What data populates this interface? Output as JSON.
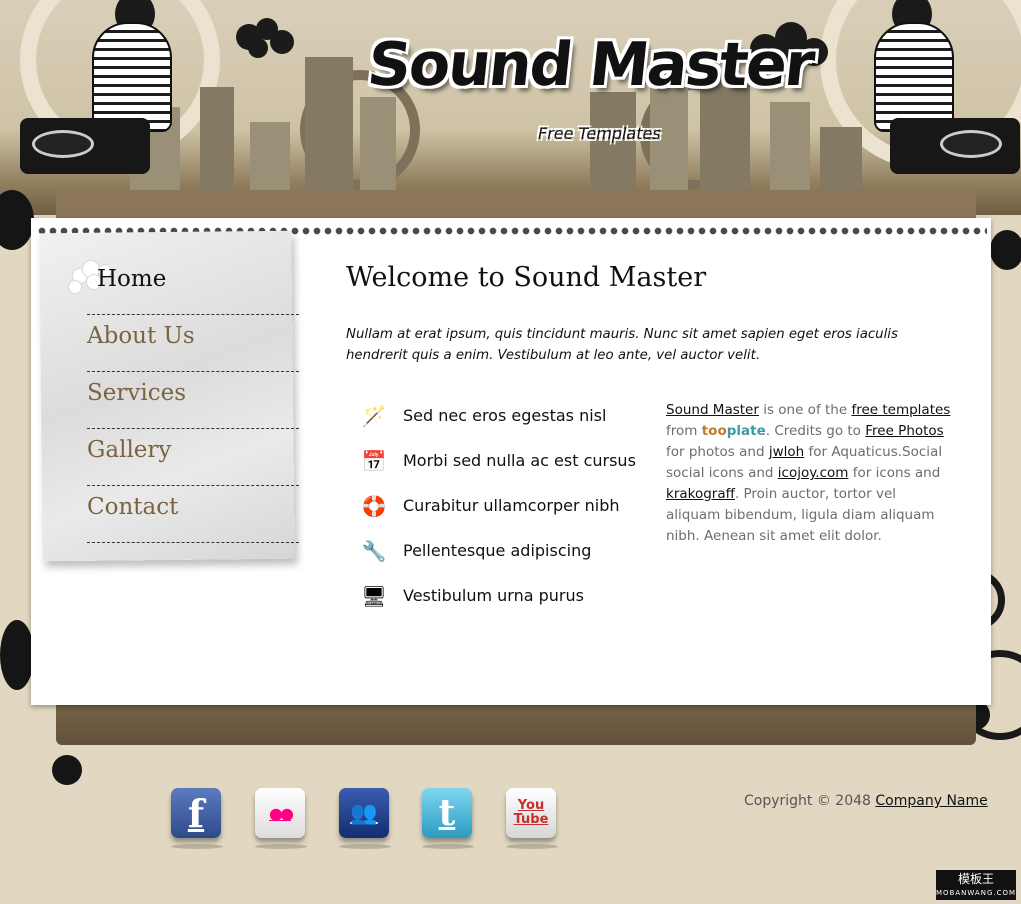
{
  "brand": {
    "title": "Sound Master",
    "tagline": "Free Templates"
  },
  "nav": {
    "items": [
      {
        "label": "Home",
        "active": true
      },
      {
        "label": "About Us",
        "active": false
      },
      {
        "label": "Services",
        "active": false
      },
      {
        "label": "Gallery",
        "active": false
      },
      {
        "label": "Contact",
        "active": false
      }
    ]
  },
  "main": {
    "heading": "Welcome to Sound Master",
    "intro": "Nullam at erat ipsum, quis tincidunt mauris. Nunc sit amet sapien eget eros iaculis hendrerit quis a enim. Vestibulum at leo ante, vel auctor velit.",
    "features": [
      {
        "icon": "magic-wand-icon",
        "glyph": "🪄",
        "label": "Sed nec eros egestas nisl"
      },
      {
        "icon": "calendar-icon",
        "glyph": "📅",
        "label": "Morbi sed nulla ac est cursus"
      },
      {
        "icon": "lifebuoy-icon",
        "glyph": "🛟",
        "label": "Curabitur ullamcorper nibh"
      },
      {
        "icon": "wrench-icon",
        "glyph": "🔧",
        "label": "Pellentesque adipiscing"
      },
      {
        "icon": "monitor-icon",
        "glyph": "🖥",
        "label": "Vestibulum urna purus"
      }
    ],
    "side": {
      "link_sound_master": "Sound Master",
      "t1": " is one of the ",
      "link_free_templates": "free templates",
      "t2": " from ",
      "too": "too",
      "plate": "plate",
      "t3": ". Credits go to ",
      "link_free_photos": "Free Photos",
      "t4": " for photos and ",
      "link_jwloh": "jwloh",
      "t5": " for Aquaticus.Social social icons and ",
      "link_icojoy": "icojoy.com",
      "t6": " for icons and ",
      "link_krakograff": "krakograff",
      "t7": ". Proin auctor, tortor vel aliquam bibendum, ligula diam aliquam nibh. Aenean sit amet elit dolor."
    }
  },
  "footer": {
    "social": [
      {
        "name": "facebook",
        "glyph": "f",
        "color": "#3b5998"
      },
      {
        "name": "flickr",
        "glyph": "●●",
        "color": "#f4f4f4"
      },
      {
        "name": "myspace",
        "glyph": "👥",
        "color": "#1f3f8a"
      },
      {
        "name": "twitter",
        "glyph": "t",
        "color": "#3fb5d6"
      },
      {
        "name": "youtube",
        "glyph": "You Tube",
        "color": "#e9e9e9"
      }
    ],
    "copyright_prefix": "Copyright © 2048 ",
    "company_link": "Company Name"
  },
  "watermark": {
    "cn": "模板王",
    "latin": "MOBANWANG.COM"
  }
}
